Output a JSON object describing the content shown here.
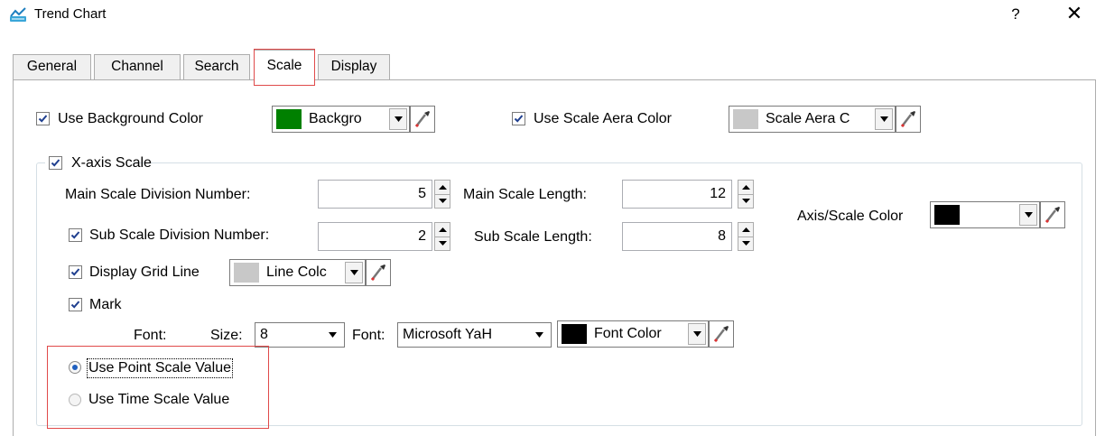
{
  "window": {
    "title": "Trend Chart",
    "help_label": "?",
    "close_label": "✕"
  },
  "tabs": [
    {
      "label": "General"
    },
    {
      "label": "Channel"
    },
    {
      "label": "Search"
    },
    {
      "label": "Scale"
    },
    {
      "label": "Display"
    }
  ],
  "active_tab": "Scale",
  "background": {
    "checkbox_label": "Use Background Color",
    "checked": true,
    "color_label": "Backgro",
    "color": "#008000"
  },
  "scale_area": {
    "checkbox_label": "Use Scale Aera Color",
    "checked": true,
    "color_label": "Scale Aera C",
    "color": "#c8c8c8"
  },
  "x_axis": {
    "group_label": "X-axis Scale",
    "checked": true,
    "main_division_label": "Main Scale Division Number:",
    "main_division_value": "5",
    "main_length_label": "Main Scale Length:",
    "main_length_value": "12",
    "sub_division_label": "Sub Scale Division Number:",
    "sub_division_checked": true,
    "sub_division_value": "2",
    "sub_length_label": "Sub Scale Length:",
    "sub_length_value": "8",
    "axis_color_label": "Axis/Scale Color",
    "axis_color": "#000000",
    "grid_label": "Display Grid Line",
    "grid_checked": true,
    "grid_color_label": "Line Colc",
    "grid_color": "#c8c8c8",
    "mark_label": "Mark",
    "mark_checked": true,
    "font_caption": "Font:",
    "size_label": "Size:",
    "size_value": "8",
    "font_label": "Font:",
    "font_value": "Microsoft YaH",
    "font_color_label": "Font Color",
    "font_color": "#000000",
    "point_value_label": "Use Point Scale Value",
    "time_value_label": "Use Time Scale Value",
    "selected_value_type": "point"
  },
  "colors": {
    "highlight": "#e04a4a",
    "radio_dot": "#1f5fbf"
  }
}
